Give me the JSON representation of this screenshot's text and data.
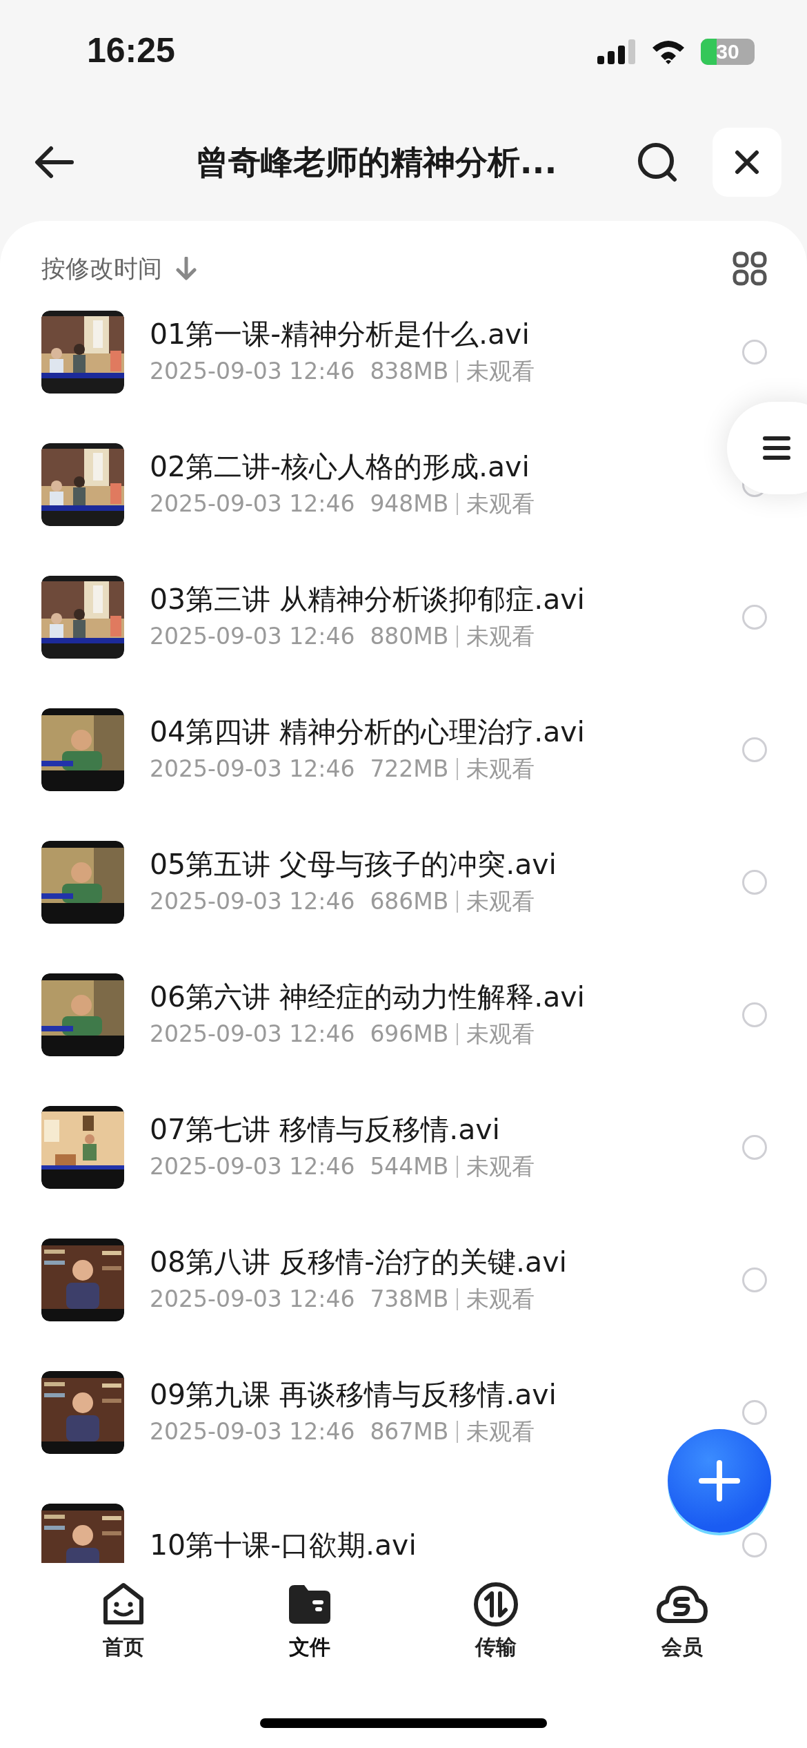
{
  "status_bar": {
    "time": "16:25",
    "battery": "30"
  },
  "header": {
    "title": "曾奇峰老师的精神分析..."
  },
  "sort": {
    "label": "按修改时间"
  },
  "files": [
    {
      "title": "01第一课-精神分析是什么.avi",
      "date": "2025-09-03 12:46",
      "size": "838MB",
      "status": "未观看",
      "selected": false
    },
    {
      "title": "02第二讲-核心人格的形成.avi",
      "date": "2025-09-03 12:46",
      "size": "948MB",
      "status": "未观看",
      "selected": false
    },
    {
      "title": "03第三讲 从精神分析谈抑郁症.avi",
      "date": "2025-09-03 12:46",
      "size": "880MB",
      "status": "未观看",
      "selected": false
    },
    {
      "title": "04第四讲 精神分析的心理治疗.avi",
      "date": "2025-09-03 12:46",
      "size": "722MB",
      "status": "未观看",
      "selected": false
    },
    {
      "title": "05第五讲 父母与孩子的冲突.avi",
      "date": "2025-09-03 12:46",
      "size": "686MB",
      "status": "未观看",
      "selected": false
    },
    {
      "title": "06第六讲 神经症的动力性解释.avi",
      "date": "2025-09-03 12:46",
      "size": "696MB",
      "status": "未观看",
      "selected": false
    },
    {
      "title": "07第七讲 移情与反移情.avi",
      "date": "2025-09-03 12:46",
      "size": "544MB",
      "status": "未观看",
      "selected": false
    },
    {
      "title": "08第八讲 反移情-治疗的关键.avi",
      "date": "2025-09-03 12:46",
      "size": "738MB",
      "status": "未观看",
      "selected": false
    },
    {
      "title": "09第九课 再谈移情与反移情.avi",
      "date": "2025-09-03 12:46",
      "size": "867MB",
      "status": "未观看",
      "selected": false
    },
    {
      "title": "10第十课-口欲期.avi",
      "selected": false
    }
  ],
  "nav": [
    {
      "label": "首页",
      "kind": "home",
      "selected": false
    },
    {
      "label": "文件",
      "kind": "files",
      "selected": true
    },
    {
      "label": "传输",
      "kind": "transfer",
      "selected": false
    },
    {
      "label": "会员",
      "kind": "member",
      "selected": false
    }
  ]
}
